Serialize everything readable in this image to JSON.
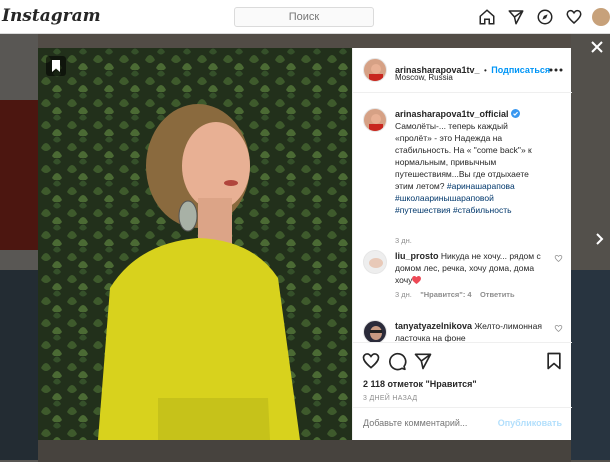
{
  "app": {
    "logo": "Instagram"
  },
  "search": {
    "placeholder": "Поиск"
  },
  "nav": {
    "icons": [
      "home-icon",
      "direct-icon",
      "explore-icon",
      "heart-icon",
      "avatar"
    ]
  },
  "post": {
    "author": "arinasharapova1tv_",
    "separator": "•",
    "follow_label": "Подписаться",
    "location": "Moscow, Russia",
    "more_icon": "more-icon"
  },
  "caption": {
    "author": "arinasharapova1tv_official",
    "verified_icon": "verified-badge-icon",
    "text": "Самолёты-... теперь каждый «пролёт» - это Надежда на стабильность. На « \"come back\"» к нормальным, привычным путешествиям...Вы где отдыхаете этим летом?",
    "hashtags": "#аринашарапова #школааринышараповой #путешествия #стабильность",
    "time": "3 дн."
  },
  "comments": [
    {
      "author": "liu_prosto",
      "text": "Никуда не хочу... рядом с домом лес, речка, хочу дома, дома хочу",
      "time": "3 дн.",
      "likes": "\"Нравится\": 4",
      "reply": "Ответить"
    },
    {
      "author": "tanyatyazelnikova",
      "text": "Желто-лимонная ласточка на фоне"
    }
  ],
  "actions": {
    "like_icon": "heart-icon",
    "comment_icon": "comment-icon",
    "share_icon": "share-icon",
    "save_icon": "bookmark-icon"
  },
  "likes_text": "2 118 отметок \"Нравится\"",
  "posted_ago": "3 ДНЕЙ НАЗАД",
  "add_comment": {
    "placeholder": "Добавьте комментарий...",
    "publish_label": "Опубликовать"
  },
  "colors": {
    "accent": "#0095f6",
    "publish_disabled": "#b2dffc",
    "hashtag": "#00376b",
    "heart_red": "#ed4956"
  }
}
